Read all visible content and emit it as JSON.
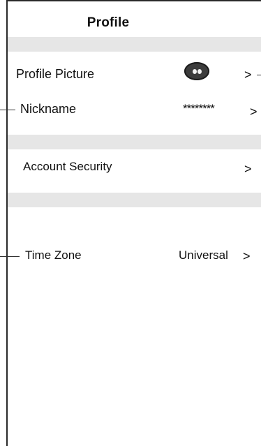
{
  "header": {
    "title": "Profile"
  },
  "rows": {
    "profile_picture": {
      "label": "Profile Picture",
      "avatar_icon": "robot-face-icon",
      "chevron": ">"
    },
    "nickname": {
      "label": "Nickname",
      "value": "********",
      "chevron": ">"
    },
    "account_security": {
      "label": "Account Security",
      "chevron": ">"
    },
    "time_zone": {
      "label": "Time Zone",
      "value": "Universal",
      "chevron": ">"
    }
  },
  "colors": {
    "separator_band": "#e6e6e6",
    "text": "#111111",
    "avatar": "#3c3c3c"
  }
}
